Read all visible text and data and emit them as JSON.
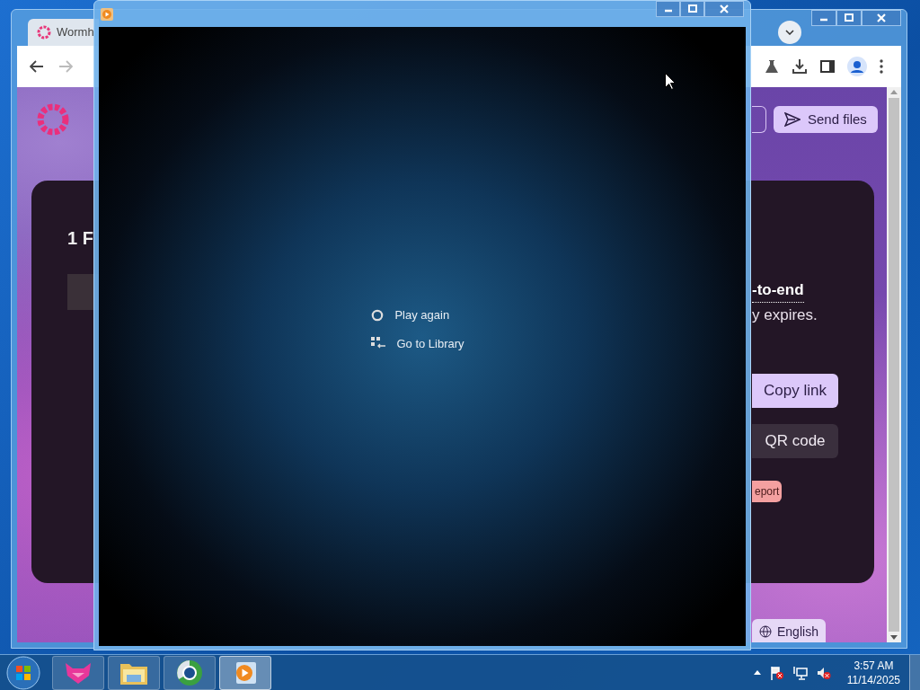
{
  "browser_window": {
    "tab_title": "Wormh",
    "toolbar": {
      "forward_disabled": true
    },
    "page": {
      "heading": "1 F",
      "send_button": "Send files",
      "notice": [
        "-to-end",
        "y expires."
      ],
      "buttons": [
        {
          "label": "Copy link",
          "kind": "primary"
        },
        {
          "label": "QR code",
          "kind": "secondary"
        }
      ],
      "report_button": "eport",
      "language_button": "English"
    }
  },
  "player_window": {
    "menu": [
      {
        "label": "Play again",
        "kind": "replay"
      },
      {
        "label": "Go to Library",
        "kind": "library"
      }
    ]
  },
  "taskbar": {
    "apps": [
      {
        "kind": "fox",
        "selected": false
      },
      {
        "kind": "folder",
        "selected": false
      },
      {
        "kind": "browser",
        "selected": false
      },
      {
        "kind": "player",
        "selected": true
      }
    ],
    "clock": {
      "time": "3:57 AM",
      "date": "11/14/2025"
    }
  }
}
